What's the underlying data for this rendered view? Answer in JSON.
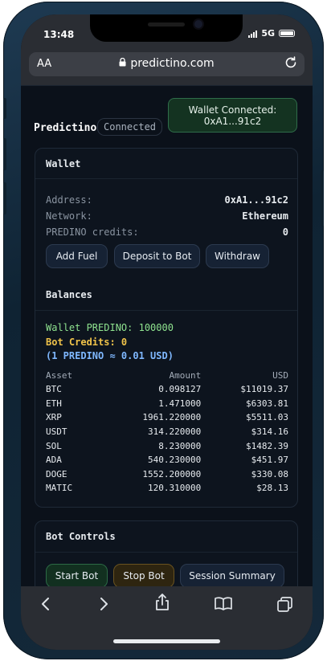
{
  "status": {
    "time": "13:48",
    "network": "5G"
  },
  "browser": {
    "aa_label": "AA",
    "url": "predictino.com"
  },
  "header": {
    "brand": "Predictino",
    "connection_status": "Connected",
    "wallet_button_line1": "Wallet Connected:",
    "wallet_button_line2": "0xA1...91c2"
  },
  "wallet": {
    "title": "Wallet",
    "address_label": "Address:",
    "address_value": "0xA1...91c2",
    "network_label": "Network:",
    "network_value": "Ethereum",
    "credits_label": "PREDINO credits:",
    "credits_value": "0",
    "buttons": {
      "add_fuel": "Add Fuel",
      "deposit": "Deposit to Bot",
      "withdraw": "Withdraw"
    }
  },
  "balances": {
    "title": "Balances",
    "wallet_predino": "Wallet PREDINO: 100000",
    "bot_credits": "Bot Credits: 0",
    "rate": "(1 PREDINO ≈ 0.01 USD)",
    "columns": [
      "Asset",
      "Amount",
      "USD"
    ],
    "rows": [
      [
        "BTC",
        "0.098127",
        "$11019.37"
      ],
      [
        "ETH",
        "1.471000",
        "$6303.81"
      ],
      [
        "XRP",
        "1961.220000",
        "$5511.03"
      ],
      [
        "USDT",
        "314.220000",
        "$314.16"
      ],
      [
        "SOL",
        "8.230000",
        "$1482.39"
      ],
      [
        "ADA",
        "540.230000",
        "$451.97"
      ],
      [
        "DOGE",
        "1552.200000",
        "$330.08"
      ],
      [
        "MATIC",
        "120.310000",
        "$28.13"
      ]
    ]
  },
  "bot_controls": {
    "title": "Bot Controls",
    "start": "Start Bot",
    "stop": "Stop Bot",
    "summary": "Session Summary"
  },
  "colors": {
    "accent_green": "#8fe38f",
    "accent_yellow": "#f0c34a",
    "wallet_button_bg": "#143321"
  }
}
